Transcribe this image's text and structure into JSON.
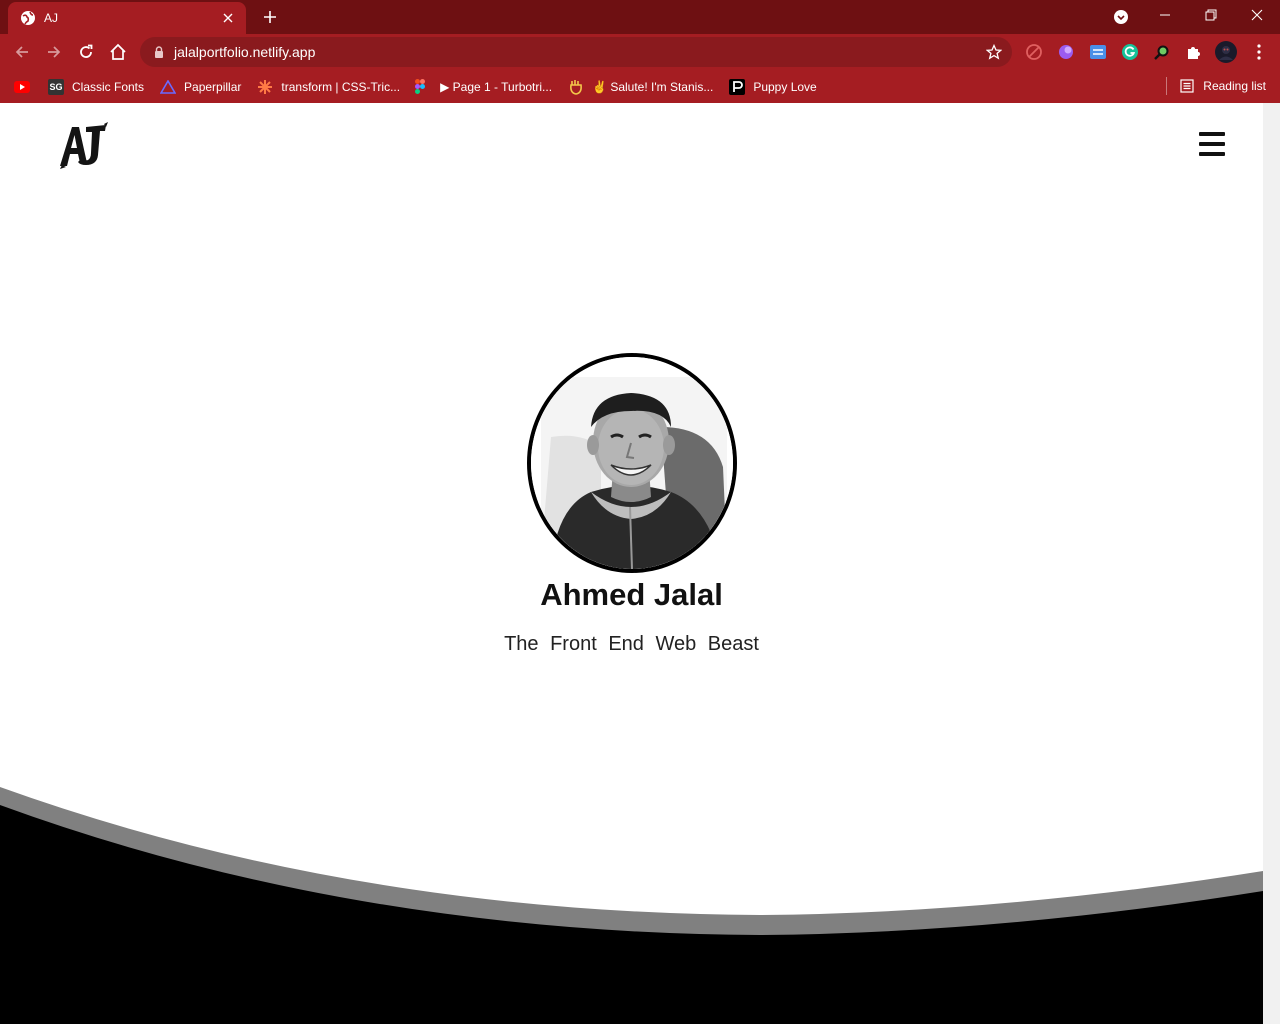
{
  "browser": {
    "tab": {
      "title": "AJ"
    },
    "address": {
      "url": "jalalportfolio.netlify.app"
    },
    "bookmarks": [
      {
        "label": "",
        "icon": "youtube-icon"
      },
      {
        "label": "Classic Fonts",
        "icon": "sg-icon",
        "badge": "SG"
      },
      {
        "label": "Paperpillar",
        "icon": "paperpillar-icon"
      },
      {
        "label": "transform | CSS-Tric...",
        "icon": "css-tricks-icon"
      },
      {
        "label": "",
        "icon": "figma-icon"
      },
      {
        "label": "▶ Page 1 - Turbotri...",
        "icon": "turbotri-icon"
      },
      {
        "label": "✌ Salute! I'm Stanis...",
        "icon": "salute-icon"
      },
      {
        "label": "Puppy Love",
        "icon": "puppy-love-icon"
      }
    ],
    "reading_list": "Reading list",
    "colors": {
      "frame": "#6e1012",
      "toolbar": "#a51d22",
      "omnibox": "#8a1a1e"
    }
  },
  "page": {
    "logo_text": "AJ",
    "name": "Ahmed Jalal",
    "tagline": "The Front End Web Beast"
  }
}
